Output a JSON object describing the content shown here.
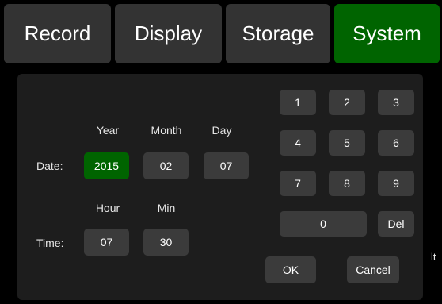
{
  "tabs": [
    {
      "label": "Record"
    },
    {
      "label": "Display"
    },
    {
      "label": "Storage"
    },
    {
      "label": "System"
    }
  ],
  "active_tab": "System",
  "date": {
    "label": "Date:",
    "year_header": "Year",
    "month_header": "Month",
    "day_header": "Day",
    "year": "2015",
    "month": "02",
    "day": "07"
  },
  "time": {
    "label": "Time:",
    "hour_header": "Hour",
    "min_header": "Min",
    "hour": "07",
    "min": "30"
  },
  "keypad": {
    "k1": "1",
    "k2": "2",
    "k3": "3",
    "k4": "4",
    "k5": "5",
    "k6": "6",
    "k7": "7",
    "k8": "8",
    "k9": "9",
    "k0": "0",
    "del": "Del"
  },
  "actions": {
    "ok": "OK",
    "cancel": "Cancel"
  },
  "edge_fragment": "lt",
  "colors": {
    "background": "#000000",
    "panel": "#1d1d1d",
    "button": "#3b3b3b",
    "tab": "#333333",
    "accent": "#006400",
    "text": "#ffffff"
  }
}
